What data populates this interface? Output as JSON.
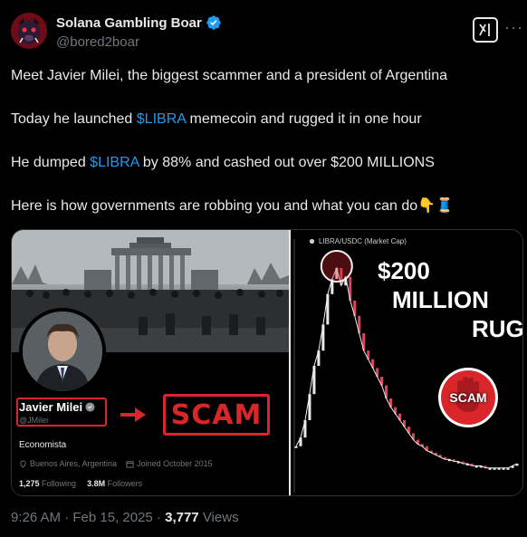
{
  "author": {
    "display_name": "Solana Gambling Boar",
    "handle": "@bored2boar",
    "verified": true,
    "avatar_icon": "boar-avatar-icon"
  },
  "header_actions": {
    "grok_icon": "grok-icon",
    "more_label": "···"
  },
  "tweet": {
    "line1": "Meet Javier Milei, the biggest scammer and a president of Argentina",
    "line2_pre": "Today he launched ",
    "line2_cashtag": "$LIBRA",
    "line2_post": " memecoin and rugged it in one hour",
    "line3_pre": "He dumped ",
    "line3_cashtag": "$LIBRA",
    "line3_post": " by 88% and cashed out over $200 MILLIONS",
    "line4": "Here is how governments are robbing you and what you can do👇🧵"
  },
  "media": {
    "profile_card": {
      "name": "Javier Milei",
      "handle": "@JMilei",
      "bio": "Economista",
      "location": "Buenos Aires, Argentina",
      "joined": "Joined October 2015",
      "following_count": "1,275",
      "following_label": "Following",
      "followers_count": "3.8M",
      "followers_label": "Followers",
      "scam_label": "SCAM"
    },
    "chart": {
      "pair_label": "LIBRA/USDC (Market Cap)",
      "headline_amount": "$200",
      "headline_million": "MILLION",
      "headline_rug": "RUG",
      "badge_label": "SCAM"
    }
  },
  "chart_data": {
    "type": "line",
    "title": "LIBRA/USDC (Market Cap)",
    "xlabel": "",
    "ylabel": "",
    "x": [
      0,
      1,
      2,
      3,
      4,
      5,
      6,
      7,
      8,
      9,
      10,
      11,
      12,
      13,
      14,
      15,
      16,
      17,
      18,
      19,
      20,
      21,
      22,
      23,
      24,
      25,
      26,
      27,
      28,
      29,
      30,
      31,
      32,
      33,
      34,
      35,
      36,
      37,
      38,
      39,
      40,
      41,
      42,
      43,
      44,
      45,
      46,
      47,
      48,
      49
    ],
    "series": [
      {
        "values": [
          18,
          22,
          30,
          42,
          55,
          62,
          74,
          88,
          95,
          100,
          92,
          96,
          85,
          78,
          70,
          62,
          58,
          54,
          50,
          46,
          40,
          36,
          33,
          30,
          27,
          24,
          21,
          19,
          18,
          16,
          15,
          14,
          13,
          12,
          12,
          11,
          11,
          10,
          10,
          9,
          9,
          9,
          8,
          8,
          8,
          8,
          8,
          8,
          9,
          10
        ]
      }
    ],
    "grid": false,
    "legend": "none"
  },
  "footer": {
    "time": "9:26 AM · Feb 15, 2025 · ",
    "views_count": "3,777",
    "views_label": " Views"
  },
  "colors": {
    "accent": "#1d9bf0",
    "scam_red": "#d8262b",
    "muted": "#71767b"
  }
}
